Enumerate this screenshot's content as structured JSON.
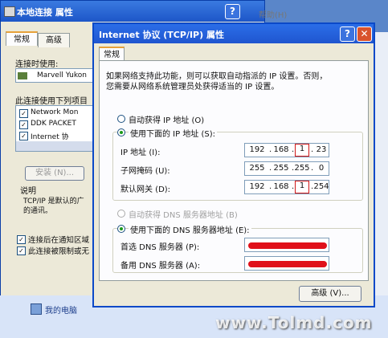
{
  "background_window": {
    "title": "本地连接 属性",
    "tabs": [
      "常规",
      "高级"
    ],
    "connect_using_label": "连接时使用:",
    "adapter_name": "Marvell Yukon",
    "items_label": "此连接使用下列项目",
    "items": [
      {
        "label": "Network Mon",
        "checked": true
      },
      {
        "label": "DDK PACKET",
        "checked": true
      },
      {
        "label": "Internet 协",
        "checked": true
      }
    ],
    "install_button": "安装 (N)...",
    "description_label": "说明",
    "description_text": [
      "TCP/IP 是默认的广",
      "的通讯。"
    ],
    "notify_checkbox": {
      "label": "连接后在通知区域",
      "checked": true
    },
    "limited_checkbox": {
      "label": "此连接被限制或无",
      "checked": true
    },
    "help_menu": "帮助(H)"
  },
  "desktop": {
    "my_computer_label": "我的电脑",
    "watermark": "www.Tolmd.com"
  },
  "dialog": {
    "title": "Internet 协议 (TCP/IP) 属性",
    "tab": "常规",
    "intro": [
      "如果网络支持此功能，则可以获取自动指派的 IP 设置。否则，",
      "您需要从网络系统管理员处获得适当的 IP 设置。"
    ],
    "auto_ip_label": "自动获得 IP 地址 (O)",
    "manual_ip_label": "使用下面的 IP 地址 (S):",
    "ip_address": {
      "label": "IP 地址 (I):",
      "segments": [
        "192",
        "168",
        "1",
        "23"
      ]
    },
    "subnet_mask": {
      "label": "子网掩码 (U):",
      "segments": [
        "255",
        "255",
        "255",
        "0"
      ]
    },
    "gateway": {
      "label": "默认网关 (D):",
      "segments": [
        "192",
        "168",
        "1",
        "254"
      ]
    },
    "auto_dns_label": "自动获得 DNS 服务器地址 (B)",
    "manual_dns_label": "使用下面的 DNS 服务器地址 (E):",
    "preferred_dns_label": "首选 DNS 服务器 (P):",
    "alternate_dns_label": "备用 DNS 服务器 (A):",
    "advanced_button": "高级 (V)...",
    "help_glyph": "?",
    "close_glyph": "✕"
  },
  "colors": {
    "title_bar": "#1f55cf",
    "highlight_box": "#d01818",
    "redaction": "#e0101a",
    "selected_radio": "#1a9a1a"
  }
}
